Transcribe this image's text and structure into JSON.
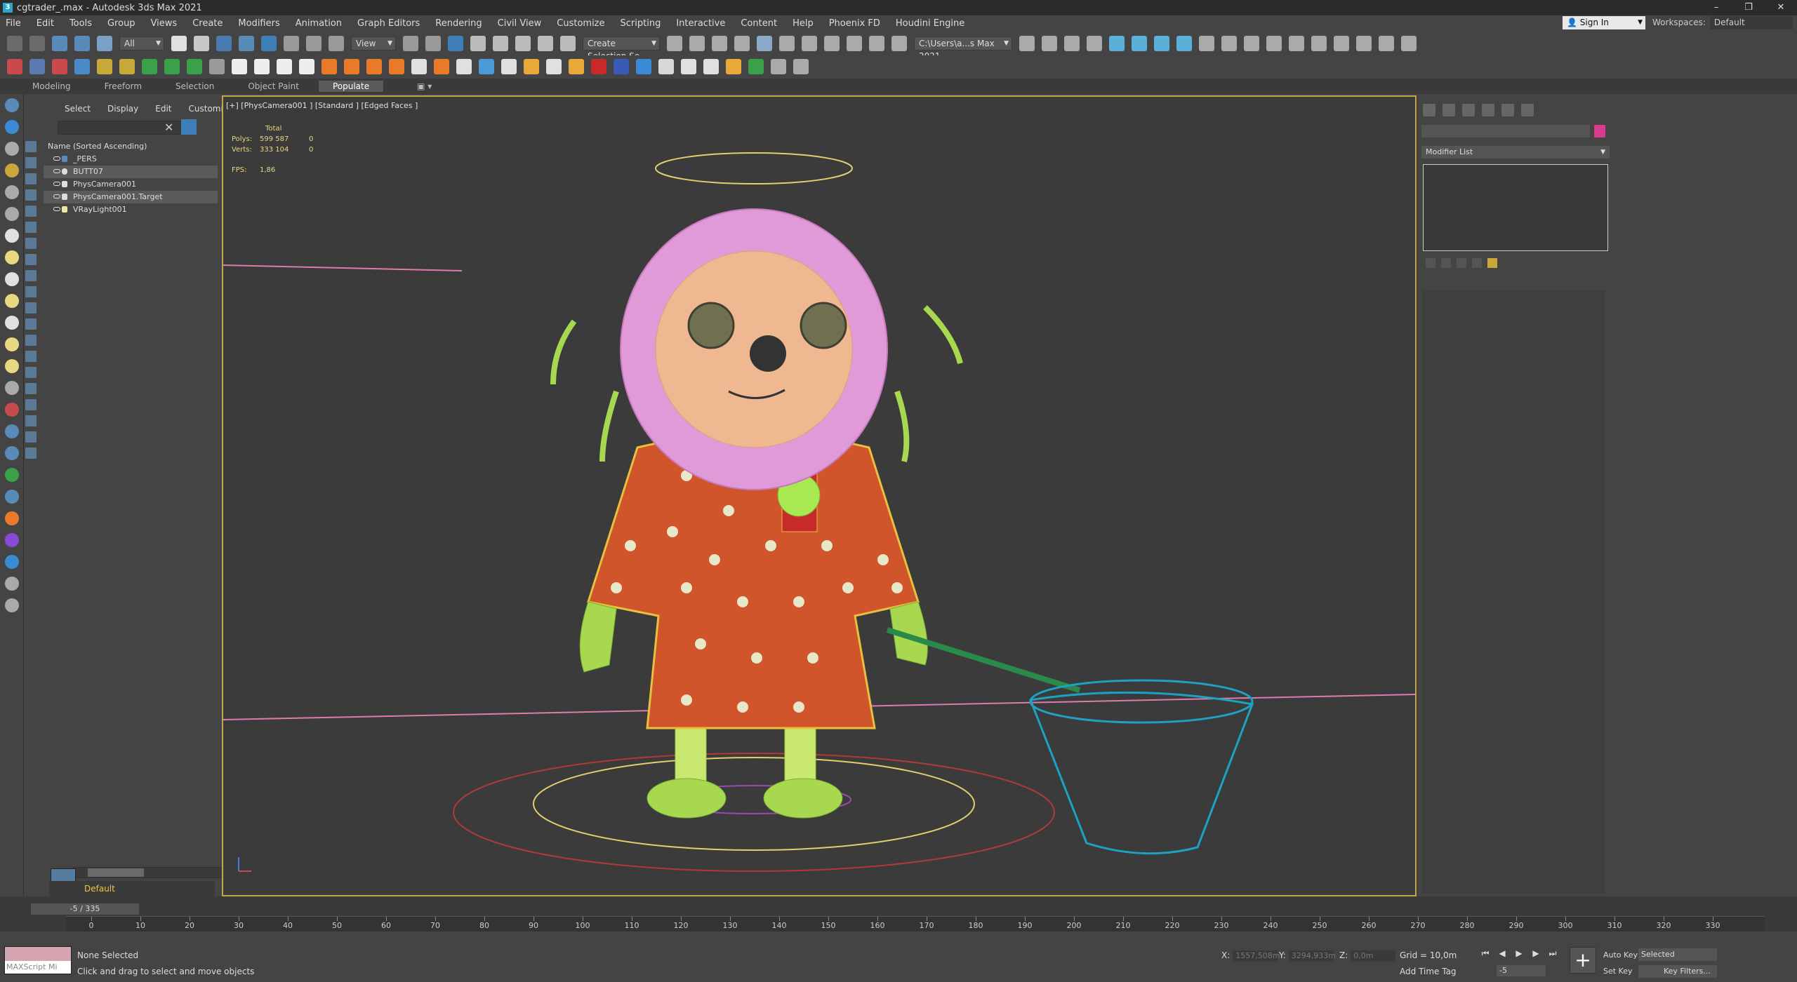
{
  "window": {
    "title": "cgtrader_.max - Autodesk 3ds Max 2021"
  },
  "menu": [
    "File",
    "Edit",
    "Tools",
    "Group",
    "Views",
    "Create",
    "Modifiers",
    "Animation",
    "Graph Editors",
    "Rendering",
    "Civil View",
    "Customize",
    "Scripting",
    "Interactive",
    "Content",
    "Help",
    "Phoenix FD",
    "Houdini Engine"
  ],
  "account": {
    "signin": "Sign In",
    "workspaces_label": "Workspaces:",
    "workspace": "Default"
  },
  "toolbar": {
    "filter": "All",
    "refcoord": "View",
    "selection_set": "Create Selection Se",
    "project_path": "C:\\Users\\a...s Max 2021"
  },
  "ribbon": {
    "tabs": [
      "Modeling",
      "Freeform",
      "Selection",
      "Object Paint",
      "Populate"
    ],
    "active": "Populate"
  },
  "scene_explorer": {
    "tabs": [
      "Select",
      "Display",
      "Edit",
      "Customize"
    ],
    "header": "Name (Sorted Ascending)",
    "items": [
      "_PERS",
      "BUTT07",
      "PhysCamera001",
      "PhysCamera001.Target",
      "VRayLight001"
    ],
    "layer": "Default"
  },
  "viewport": {
    "label": "[+] [PhysCamera001 ] [Standard ] [Edged Faces ]",
    "stats": {
      "total_label": "Total",
      "polys_label": "Polys:",
      "polys": "599 587",
      "polys_sel": "0",
      "verts_label": "Verts:",
      "verts": "333 104",
      "verts_sel": "0",
      "fps_label": "FPS:",
      "fps": "1,86"
    }
  },
  "command_panel": {
    "modifier_list": "Modifier List"
  },
  "timeline": {
    "slider": "-5 / 335",
    "ticks": [
      "0",
      "10",
      "20",
      "30",
      "40",
      "50",
      "60",
      "70",
      "80",
      "90",
      "100",
      "110",
      "120",
      "130",
      "140",
      "150",
      "160",
      "170",
      "180",
      "190",
      "200",
      "210",
      "220",
      "230",
      "240",
      "250",
      "260",
      "270",
      "280",
      "290",
      "300",
      "310",
      "320",
      "330"
    ]
  },
  "status": {
    "maxscript": "MAXScript Mi",
    "selection": "None Selected",
    "prompt": "Click and drag to select and move objects",
    "x_label": "X:",
    "x": "1557,508m",
    "y_label": "Y:",
    "y": "3294,933m",
    "z_label": "Z:",
    "z": "0,0m",
    "grid": "Grid = 10,0m",
    "add_time_tag": "Add Time Tag",
    "frame": "-5",
    "auto_key": "Auto Key",
    "set_key": "Set Key",
    "selected": "Selected",
    "key_filters": "Key Filters..."
  },
  "colors": {
    "accent": "#c6a64a",
    "object_color": "#d83a8e",
    "wire_body": "#d8b23a",
    "hair": "#e09ad8",
    "net": "#1ea2c4"
  }
}
